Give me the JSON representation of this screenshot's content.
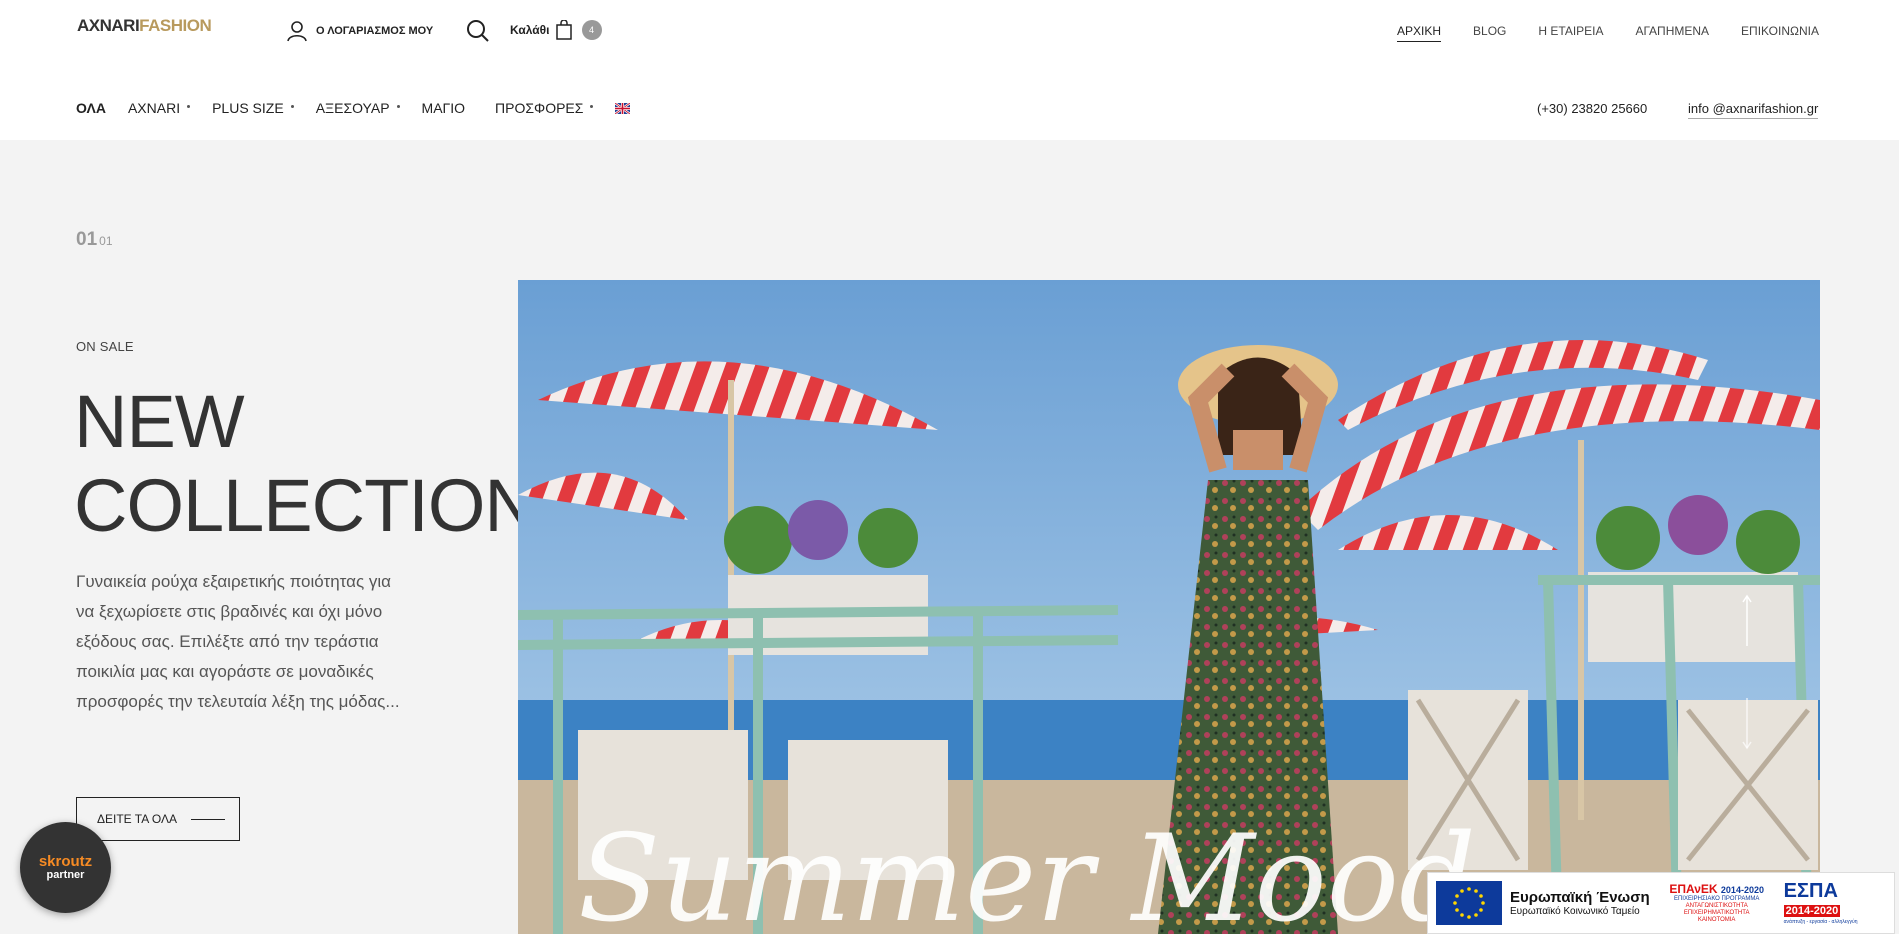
{
  "header": {
    "logo": {
      "part1": "AXNARI",
      "part2": "FASHION"
    },
    "account_label": "Ο ΛΟΓΑΡΙΑΣΜΟΣ ΜΟΥ",
    "cart_label": "Καλάθι",
    "cart_count": "4",
    "top_nav": [
      {
        "label": "ΑΡΧΙΚΗ",
        "active": true
      },
      {
        "label": "BLOG"
      },
      {
        "label": "Η ΕΤΑΙΡΕΙΑ"
      },
      {
        "label": "ΑΓΑΠΗΜΕΝΑ"
      },
      {
        "label": "ΕΠΙΚΟΙΝΩΝΙΑ"
      }
    ],
    "main_nav": [
      {
        "label": "ΟΛΑ",
        "bold": true
      },
      {
        "label": "AXNARI",
        "dropdown": true
      },
      {
        "label": "PLUS SIZE",
        "dropdown": true
      },
      {
        "label": "ΑΞΕΣΟΥΑΡ",
        "dropdown": true
      },
      {
        "label": "ΜΑΓΙΟ"
      },
      {
        "label": "ΠΡΟΣΦΟΡΕΣ",
        "dropdown": true
      }
    ],
    "language_icon": "uk-flag-icon",
    "phone": "(+30) 23820 25660",
    "email": "info @axnarifashion.gr"
  },
  "hero": {
    "slide_current": "01",
    "slide_total": "01",
    "tag": "ON SALE",
    "title_line1": "NEW",
    "title_line2": "COLLECTION",
    "description": "Γυναικεία ρούχα εξαιρετικής ποιότητας για να ξεχωρίσετε στις βραδινές και όχι μόνο εξόδους σας. Επιλέξτε από την τεράστια ποικιλία μας και αγοράστε σε μοναδικές προσφορές την τελευταία λέξη της μόδας...",
    "cta_label": "ΔΕΙΤΕ ΤΑ ΟΛΑ",
    "image_overlay_text": "Summer Mood"
  },
  "badges": {
    "skroutz_line1": "skroutz",
    "skroutz_line2": "partner",
    "eu_title": "Ευρωπαϊκή Ένωση",
    "eu_subtitle": "Ευρωπαϊκό Κοινωνικό Ταμείο",
    "epanek_title": "ΕΠΑνΕΚ",
    "epanek_years": "2014-2020",
    "epanek_line1": "ΕΠΙΧΕΙΡΗΣΙΑΚΟ ΠΡΟΓΡΑΜΜΑ",
    "epanek_line2": "ΑΝΤΑΓΩΝΙΣΤΙΚΟΤΗΤΑ",
    "epanek_line3": "ΕΠΙΧΕΙΡΗΜΑΤΙΚΟΤΗΤΑ",
    "epanek_line4": "ΚΑΙΝΟΤΟΜΙΑ",
    "espa_title": "ΕΣΠΑ",
    "espa_years": "2014-2020",
    "espa_tagline": "ανάπτυξη - εργασία - αλληλεγγύη"
  },
  "colors": {
    "accent_gold": "#b89a5e",
    "background": "#f3f3f3",
    "text_dark": "#222222"
  }
}
